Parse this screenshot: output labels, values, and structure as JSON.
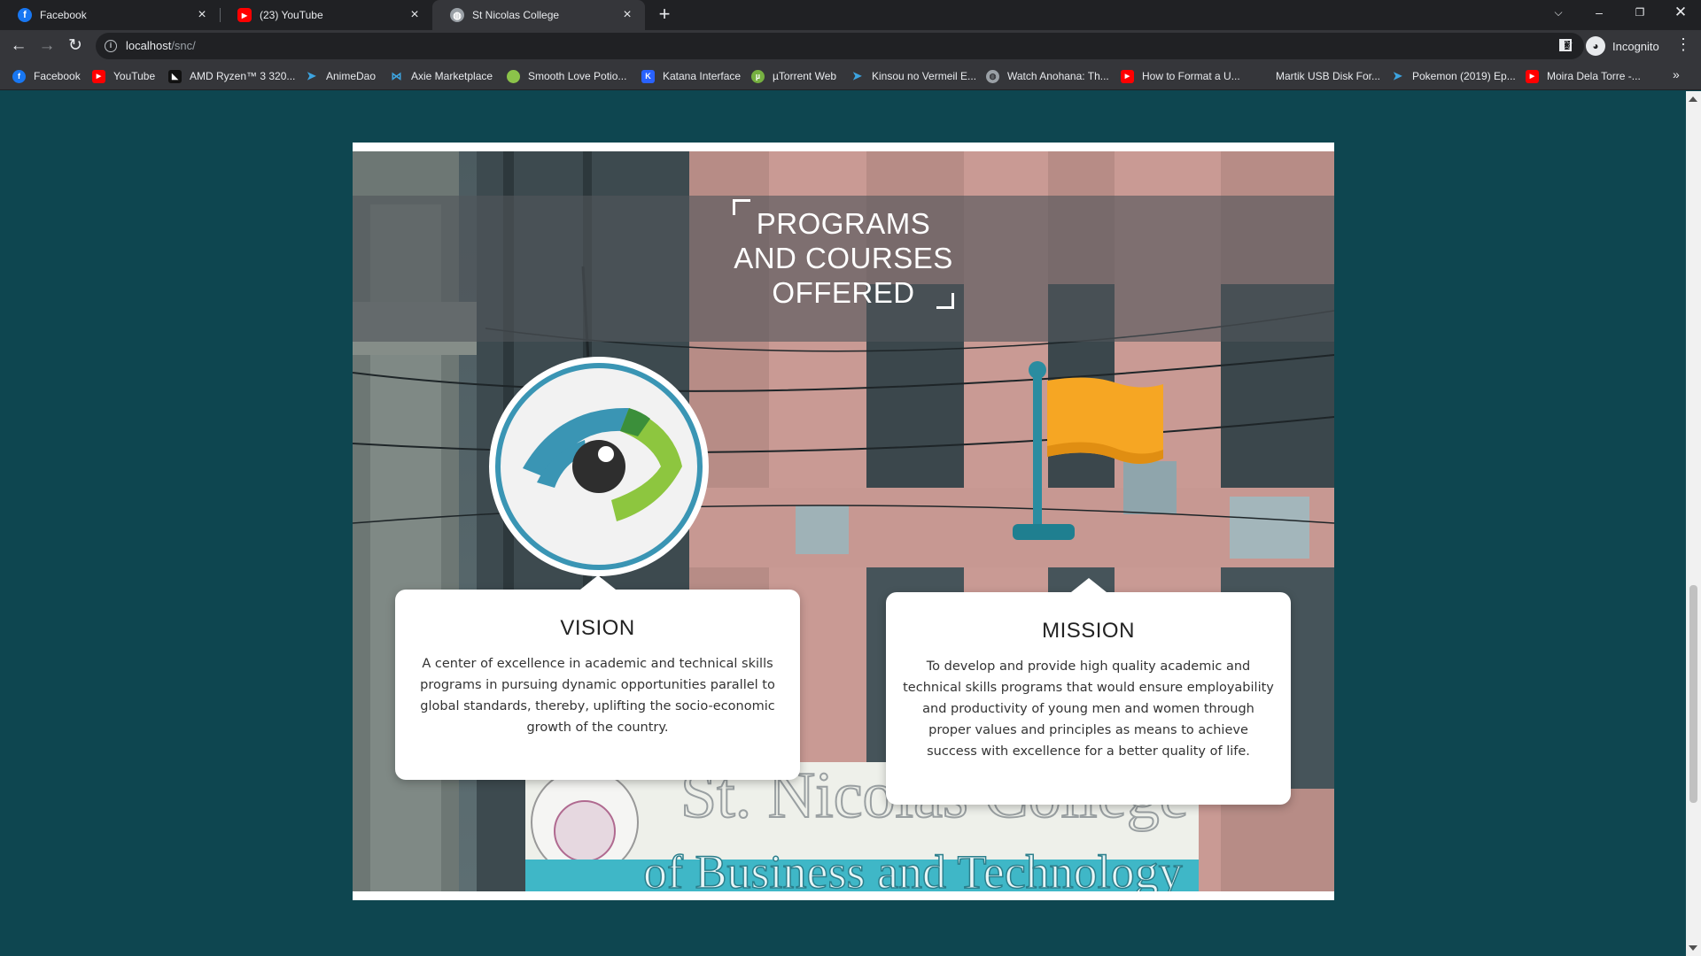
{
  "browser": {
    "tabs": [
      {
        "title": "Facebook",
        "icon": "facebook-icon",
        "color": "#1877f2"
      },
      {
        "title": "(23) YouTube",
        "icon": "youtube-icon",
        "color": "#ff0000"
      },
      {
        "title": "St Nicolas College",
        "icon": "globe-icon",
        "color": "#9aa0a6"
      }
    ],
    "url_host": "localhost",
    "url_path": "/snc/",
    "profile_label": "Incognito",
    "bookmarks": [
      {
        "label": "Facebook",
        "icon": "facebook-icon",
        "color": "#1877f2"
      },
      {
        "label": "YouTube",
        "icon": "youtube-icon",
        "color": "#ff0000"
      },
      {
        "label": "AMD Ryzen™ 3 320...",
        "icon": "amd-icon",
        "color": "#111111"
      },
      {
        "label": "AnimeDao",
        "icon": "paper-plane-icon",
        "color": "#3da4e0"
      },
      {
        "label": "Axie Marketplace",
        "icon": "axie-icon",
        "color": "#3da4e0"
      },
      {
        "label": "Smooth Love Potio...",
        "icon": "potion-icon",
        "color": "#8bc34a"
      },
      {
        "label": "Katana Interface",
        "icon": "katana-icon",
        "color": "#2962ff"
      },
      {
        "label": "µTorrent Web",
        "icon": "utorrent-icon",
        "color": "#76b041"
      },
      {
        "label": "Kinsou no Vermeil E...",
        "icon": "paper-plane-icon",
        "color": "#3da4e0"
      },
      {
        "label": "Watch Anohana: Th...",
        "icon": "globe-icon",
        "color": "#9aa0a6"
      },
      {
        "label": "How to Format a U...",
        "icon": "youtube-icon",
        "color": "#ff0000"
      },
      {
        "label": "Martik USB Disk For...",
        "icon": "blank-page-icon",
        "color": "#35363a"
      },
      {
        "label": "Pokemon (2019) Ep...",
        "icon": "paper-plane-icon",
        "color": "#3da4e0"
      },
      {
        "label": "Moira Dela Torre -...",
        "icon": "youtube-icon",
        "color": "#ff0000"
      }
    ]
  },
  "page": {
    "heading_line1": "PROGRAMS",
    "heading_line2": "AND COURSES",
    "heading_line3": "OFFERED",
    "vision": {
      "title": "VISION",
      "text": "A center of excellence in academic and technical skills programs in pursuing dynamic opportunities parallel to global standards, thereby, uplifting the socio-economic growth of the country."
    },
    "mission": {
      "title": "MISSION",
      "text": "To develop and provide high quality academic and technical skills programs that would ensure employability and productivity of young men and women through proper values and principles as means to achieve success with excellence for a better quality of life."
    },
    "building_sign_line1": "St. Nicolas College",
    "building_sign_line2": "of Business and Technology",
    "colors": {
      "background": "#0e4650",
      "eye_blue": "#3a95b4",
      "eye_green": "#8dc63f",
      "flag_orange": "#f6a623",
      "pole_teal": "#2a8ca0"
    }
  }
}
